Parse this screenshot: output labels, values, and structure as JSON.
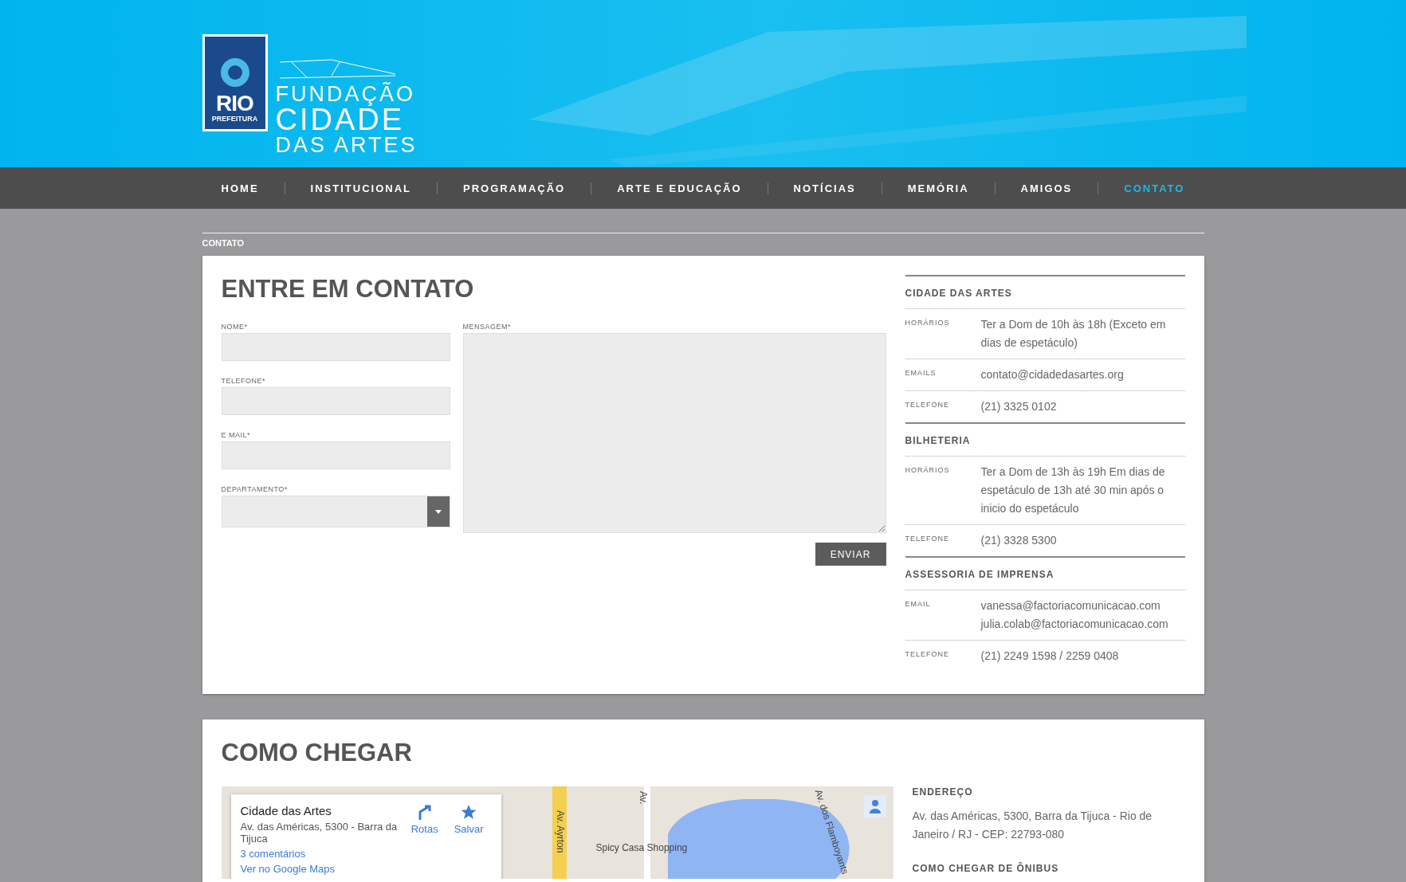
{
  "logo": {
    "emblem_word": "RIO",
    "emblem_sub": "PREFEITURA",
    "lines": [
      "FUNDAÇÃO",
      "CIDADE",
      "DAS ARTES"
    ]
  },
  "nav": [
    {
      "label": "HOME",
      "selected": false
    },
    {
      "label": "INSTITUCIONAL",
      "selected": false
    },
    {
      "label": "PROGRAMAÇÃO",
      "selected": false
    },
    {
      "label": "ARTE E EDUCAÇÃO",
      "selected": false
    },
    {
      "label": "NOTÍCIAS",
      "selected": false
    },
    {
      "label": "MEMÓRIA",
      "selected": false
    },
    {
      "label": "AMIGOS",
      "selected": false
    },
    {
      "label": "CONTATO",
      "selected": true
    }
  ],
  "breadcrumb": "CONTATO",
  "contact": {
    "title": "ENTRE EM CONTATO",
    "fields": [
      {
        "label": "NOME*",
        "kind": "input"
      },
      {
        "label": "TELEFONE*",
        "kind": "input"
      },
      {
        "label": "E MAIL*",
        "kind": "input"
      },
      {
        "label": "DEPARTAMENTO*",
        "kind": "select"
      }
    ],
    "message": {
      "label": "MENSAGEM*",
      "kind": "textarea"
    },
    "submit": "ENVIAR",
    "info": [
      {
        "title": "CIDADE DAS ARTES",
        "rows": [
          {
            "label": "HORÁRIOS",
            "lines": [
              "Ter a Dom de 10h às 18h (Exceto em dias de espetáculo)"
            ]
          },
          {
            "label": "EMAILS",
            "lines": [
              "contato@cidadedasartes.org"
            ]
          },
          {
            "label": "TELEFONE",
            "lines": [
              "(21) 3325 0102"
            ]
          }
        ]
      },
      {
        "title": "BILHETERIA",
        "rows": [
          {
            "label": "HORÁRIOS",
            "lines": [
              "Ter a Dom de 13h às 19h Em dias de espetáculo de 13h até 30 min após o inicio do espetáculo"
            ]
          },
          {
            "label": "TELEFONE",
            "lines": [
              "(21) 3328 5300"
            ]
          }
        ]
      },
      {
        "title": "ASSESSORIA DE IMPRENSA",
        "rows": [
          {
            "label": "EMAIL",
            "lines": [
              "vanessa@factoriacomunicacao.com",
              "julia.colab@factoriacomunicacao.com"
            ]
          },
          {
            "label": "TELEFONE",
            "lines": [
              "(21) 2249 1598 / 2259 0408"
            ]
          }
        ]
      }
    ]
  },
  "directions": {
    "title": "COMO CHEGAR",
    "map": {
      "place": "Cidade das Artes",
      "address": "Av. das Américas, 5300 - Barra da Tijuca",
      "reviews": "3 comentários",
      "open_link": "Ver no Google Maps",
      "actions": [
        "Rotas",
        "Salvar"
      ],
      "labels": [
        {
          "text": "Av. Ayrton",
          "kind": "vertical"
        },
        {
          "text": "Av.",
          "kind": "vertical"
        },
        {
          "text": "Av. dos Flamboyants",
          "kind": "slanted"
        },
        {
          "text": "Spicy Casa Shopping",
          "kind": "poi"
        }
      ]
    },
    "sections": [
      {
        "title": "ENDEREÇO",
        "text": "Av. das Américas, 5300, Barra da Tijuca - Rio de Janeiro / RJ - CEP: 22793-080"
      },
      {
        "title": "COMO CHEGAR DE ÔNIBUS"
      }
    ]
  }
}
